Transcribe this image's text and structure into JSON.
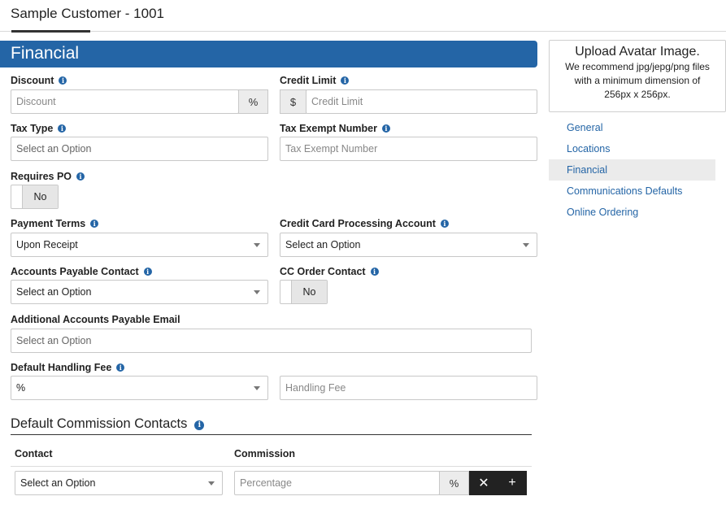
{
  "header": {
    "title": "Sample Customer - 1001"
  },
  "section": {
    "title": "Financial"
  },
  "fields": {
    "discount": {
      "label": "Discount",
      "placeholder": "Discount",
      "addon": "%"
    },
    "credit_limit": {
      "label": "Credit Limit",
      "placeholder": "Credit Limit",
      "addon": "$"
    },
    "tax_type": {
      "label": "Tax Type",
      "value": "Select an Option"
    },
    "tax_exempt_number": {
      "label": "Tax Exempt Number",
      "placeholder": "Tax Exempt Number"
    },
    "requires_po": {
      "label": "Requires PO",
      "value": "No"
    },
    "payment_terms": {
      "label": "Payment Terms",
      "value": "Upon Receipt"
    },
    "cc_processing_account": {
      "label": "Credit Card Processing Account",
      "value": "Select an Option"
    },
    "ap_contact": {
      "label": "Accounts Payable Contact",
      "value": "Select an Option"
    },
    "cc_order_contact": {
      "label": "CC Order Contact",
      "value": "No"
    },
    "additional_ap_email": {
      "label": "Additional Accounts Payable Email",
      "value": "Select an Option"
    },
    "default_handling_fee": {
      "label": "Default Handling Fee",
      "value": "%",
      "fee_placeholder": "Handling Fee"
    }
  },
  "commission": {
    "title": "Default Commission Contacts",
    "columns": {
      "contact": "Contact",
      "commission": "Commission"
    },
    "row": {
      "contact_value": "Select an Option",
      "percentage_placeholder": "Percentage",
      "addon": "%",
      "remove_label": "✕",
      "add_label": "+"
    }
  },
  "avatar": {
    "title": "Upload Avatar Image.",
    "description": "We recommend jpg/jepg/png files with a minimum dimension of 256px x 256px."
  },
  "nav": {
    "items": [
      {
        "label": "General"
      },
      {
        "label": "Locations"
      },
      {
        "label": "Financial"
      },
      {
        "label": "Communications Defaults"
      },
      {
        "label": "Online Ordering"
      }
    ],
    "active": "Financial"
  },
  "icons": {
    "info": "info-icon",
    "dropdown": "chevron-down-icon",
    "remove": "close-icon",
    "add": "plus-icon"
  },
  "colors": {
    "primary": "#2465a6",
    "dark_button": "#222222"
  }
}
